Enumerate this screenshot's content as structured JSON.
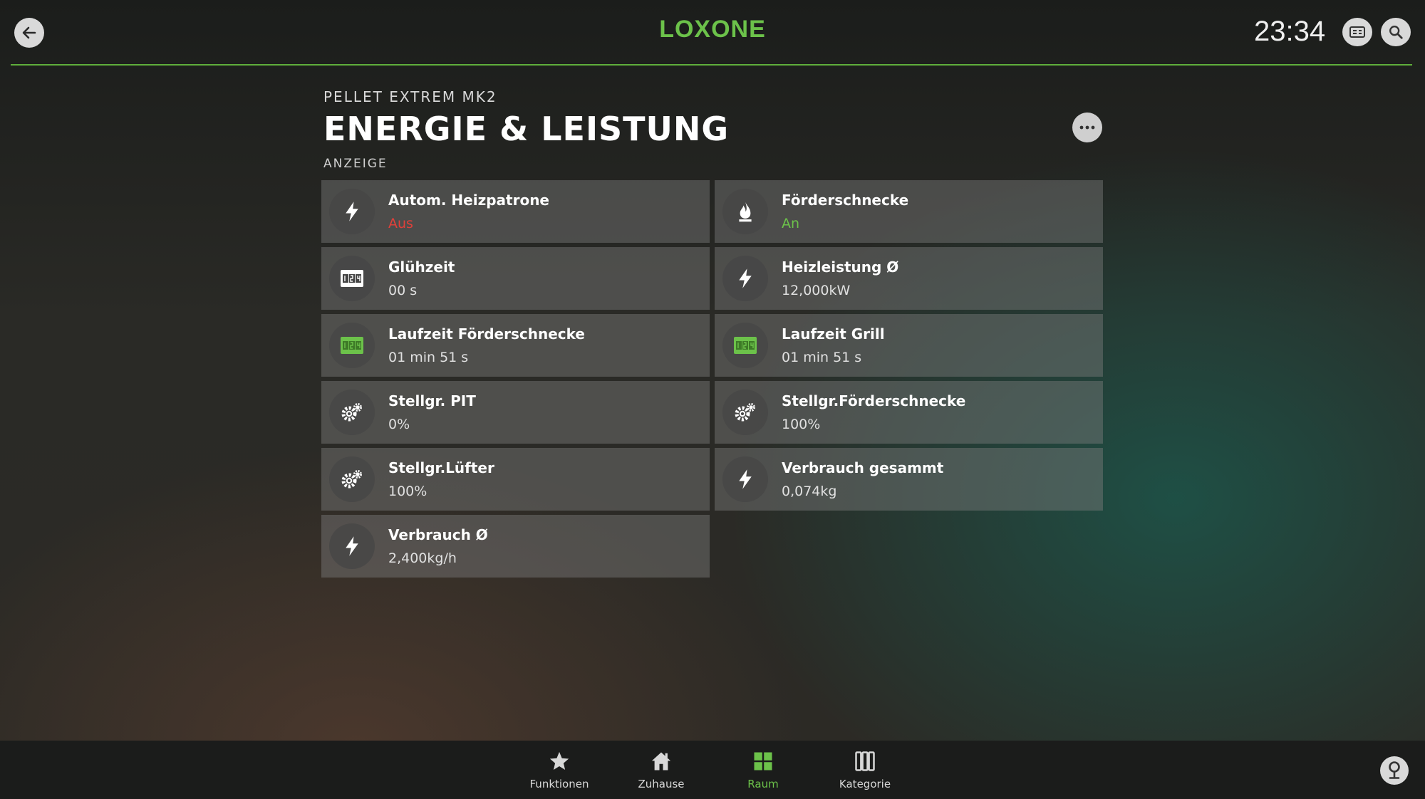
{
  "header": {
    "logo": "LOXONE",
    "clock": "23:34"
  },
  "page": {
    "subtitle": "PELLET EXTREM MK2",
    "title": "ENERGIE & LEISTUNG",
    "section": "ANZEIGE"
  },
  "colors": {
    "accent": "#6cc24a",
    "off": "#e0403a",
    "on": "#6cc24a"
  },
  "tiles": [
    {
      "title": "Autom. Heizpatrone",
      "value": "Aus",
      "icon": "lightning-icon"
    },
    {
      "title": "Förderschnecke",
      "value": "An",
      "icon": "flame-icon"
    },
    {
      "title": "Glühzeit",
      "value": "00 s",
      "icon": "counter-icon"
    },
    {
      "title": "Heizleistung Ø",
      "value": "12,000kW",
      "icon": "lightning-icon"
    },
    {
      "title": "Laufzeit Förderschnecke",
      "value": "01 min 51 s",
      "icon": "counter-icon"
    },
    {
      "title": "Laufzeit Grill",
      "value": "01 min 51 s",
      "icon": "counter-icon"
    },
    {
      "title": "Stellgr. PIT",
      "value": "0%",
      "icon": "gears-icon"
    },
    {
      "title": "Stellgr.Förderschnecke",
      "value": "100%",
      "icon": "gears-icon"
    },
    {
      "title": "Stellgr.Lüfter",
      "value": "100%",
      "icon": "gears-icon"
    },
    {
      "title": "Verbrauch gesammt",
      "value": "0,074kg",
      "icon": "lightning-icon"
    },
    {
      "title": "Verbrauch Ø",
      "value": "2,400kg/h",
      "icon": "lightning-icon"
    }
  ],
  "nav": [
    {
      "label": "Funktionen",
      "icon": "star-icon"
    },
    {
      "label": "Zuhause",
      "icon": "home-icon"
    },
    {
      "label": "Raum",
      "icon": "grid-icon"
    },
    {
      "label": "Kategorie",
      "icon": "category-icon"
    }
  ]
}
